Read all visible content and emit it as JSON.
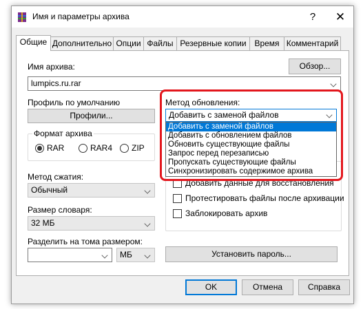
{
  "window": {
    "title": "Имя и параметры архива",
    "help_label": "?",
    "close_label": "✕"
  },
  "tabs": [
    {
      "label": "Общие",
      "active": true
    },
    {
      "label": "Дополнительно"
    },
    {
      "label": "Опции"
    },
    {
      "label": "Файлы"
    },
    {
      "label": "Резервные копии"
    },
    {
      "label": "Время"
    },
    {
      "label": "Комментарий"
    }
  ],
  "archive_name": {
    "label": "Имя архива:",
    "value": "lumpics.ru.rar",
    "browse_label": "Обзор..."
  },
  "profile": {
    "label": "Профиль по умолчанию",
    "button_label": "Профили..."
  },
  "update_method": {
    "label": "Метод обновления:",
    "selected": "Добавить с заменой файлов",
    "options": [
      "Добавить с заменой файлов",
      "Добавить с обновлением файлов",
      "Обновить существующие файлы",
      "Запрос перед перезаписью",
      "Пропускать существующие файлы",
      "Синхронизировать содержимое архива"
    ]
  },
  "archive_format": {
    "label": "Формат архива",
    "options": [
      "RAR",
      "RAR4",
      "ZIP"
    ],
    "selected": "RAR"
  },
  "compression": {
    "label": "Метод сжатия:",
    "value": "Обычный"
  },
  "dictionary": {
    "label": "Размер словаря:",
    "value": "32 МБ"
  },
  "split": {
    "label": "Разделить на тома размером:",
    "value": "",
    "unit": "МБ"
  },
  "archive_options": {
    "partial_option": "...",
    "items": [
      {
        "label": "Добавить данные для восстановления",
        "checked": false
      },
      {
        "label": "Протестировать файлы после архивации",
        "checked": false
      },
      {
        "label": "Заблокировать архив",
        "checked": false
      }
    ]
  },
  "password_button": "Установить пароль...",
  "footer": {
    "ok": "OK",
    "cancel": "Отмена",
    "help": "Справка"
  },
  "colors": {
    "highlight": "#e3161c",
    "selection": "#0078d7"
  }
}
